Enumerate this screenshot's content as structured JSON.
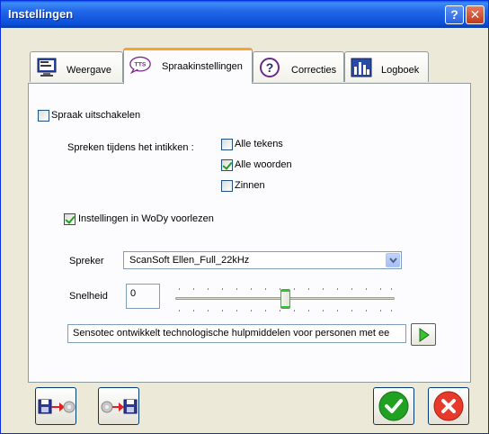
{
  "window": {
    "title": "Instellingen",
    "help_icon": "help-icon",
    "close_icon": "close-icon"
  },
  "tabs": [
    {
      "label": "Weergave",
      "icon": "monitor-icon",
      "active": false
    },
    {
      "label": "Spraakinstellingen",
      "icon": "tts-icon",
      "active": true
    },
    {
      "label": "Correcties",
      "icon": "question-icon",
      "active": false
    },
    {
      "label": "Logboek",
      "icon": "bar-chart-icon",
      "active": false
    }
  ],
  "speech": {
    "disable_label": "Spraak uitschakelen",
    "disable_checked": false,
    "while_typing_label": "Spreken tijdens het intikken :",
    "options": [
      {
        "label": "Alle tekens",
        "checked": false
      },
      {
        "label": "Alle woorden",
        "checked": true
      },
      {
        "label": "Zinnen",
        "checked": false
      }
    ],
    "read_settings_label": "Instellingen in WoDy voorlezen",
    "read_settings_checked": true
  },
  "speaker": {
    "label": "Spreker",
    "value": "ScanSoft Ellen_Full_22kHz"
  },
  "speed": {
    "label": "Snelheid",
    "value": "0",
    "slider_fraction": 0.5
  },
  "preview": {
    "text": "Sensotec ontwikkelt technologische hulpmiddelen voor personen met ee",
    "play_icon": "play-icon"
  },
  "bottom_buttons": [
    {
      "name": "export-settings-button",
      "icon": "export-gear-icon"
    },
    {
      "name": "import-settings-button",
      "icon": "import-gear-icon"
    },
    {
      "name": "ok-button",
      "icon": "checkmark-icon"
    },
    {
      "name": "cancel-button",
      "icon": "cancel-x-icon"
    }
  ],
  "colors": {
    "titlebar": "#2266e8",
    "active_tab_accent": "#f4a72e",
    "ok_green": "#21a121",
    "cancel_red": "#e83a2a"
  }
}
